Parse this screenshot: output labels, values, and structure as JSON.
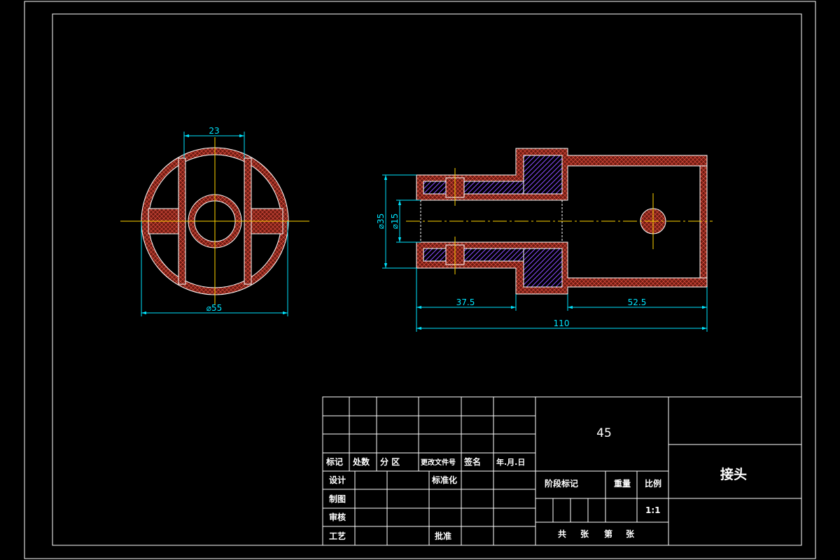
{
  "colors": {
    "background": "#000000",
    "outline": "#ffffff",
    "section_fill": "#6b1a10",
    "crosshatch": "#d2483a",
    "diag_hatch": "#8c4dff",
    "dimension": "#00e5ff",
    "centerline": "#ffd400"
  },
  "dimensions": {
    "front_width": "23",
    "front_diameter": "⌀55",
    "side_outer_diameter": "⌀35",
    "side_inner_diameter": "⌀15",
    "side_left_length": "37.5",
    "side_right_length": "52.5",
    "side_total_length": "110"
  },
  "title_block": {
    "header": {
      "mark": "标记",
      "count": "处数",
      "zone": "分 区",
      "change_doc": "更改文件号",
      "signature": "签名",
      "date": "年.月.日"
    },
    "roles": {
      "design": "设计",
      "drafting": "制图",
      "review": "审核",
      "process": "工艺",
      "standardization": "标准化",
      "approval": "批准"
    },
    "material": "45",
    "stage_mark": "阶段标记",
    "weight": "重量",
    "scale_label": "比例",
    "scale_value": "1:1",
    "sheets": {
      "total": "共",
      "sheet": "张",
      "number": "第",
      "sheet2": "张"
    },
    "part_name": "接头"
  }
}
